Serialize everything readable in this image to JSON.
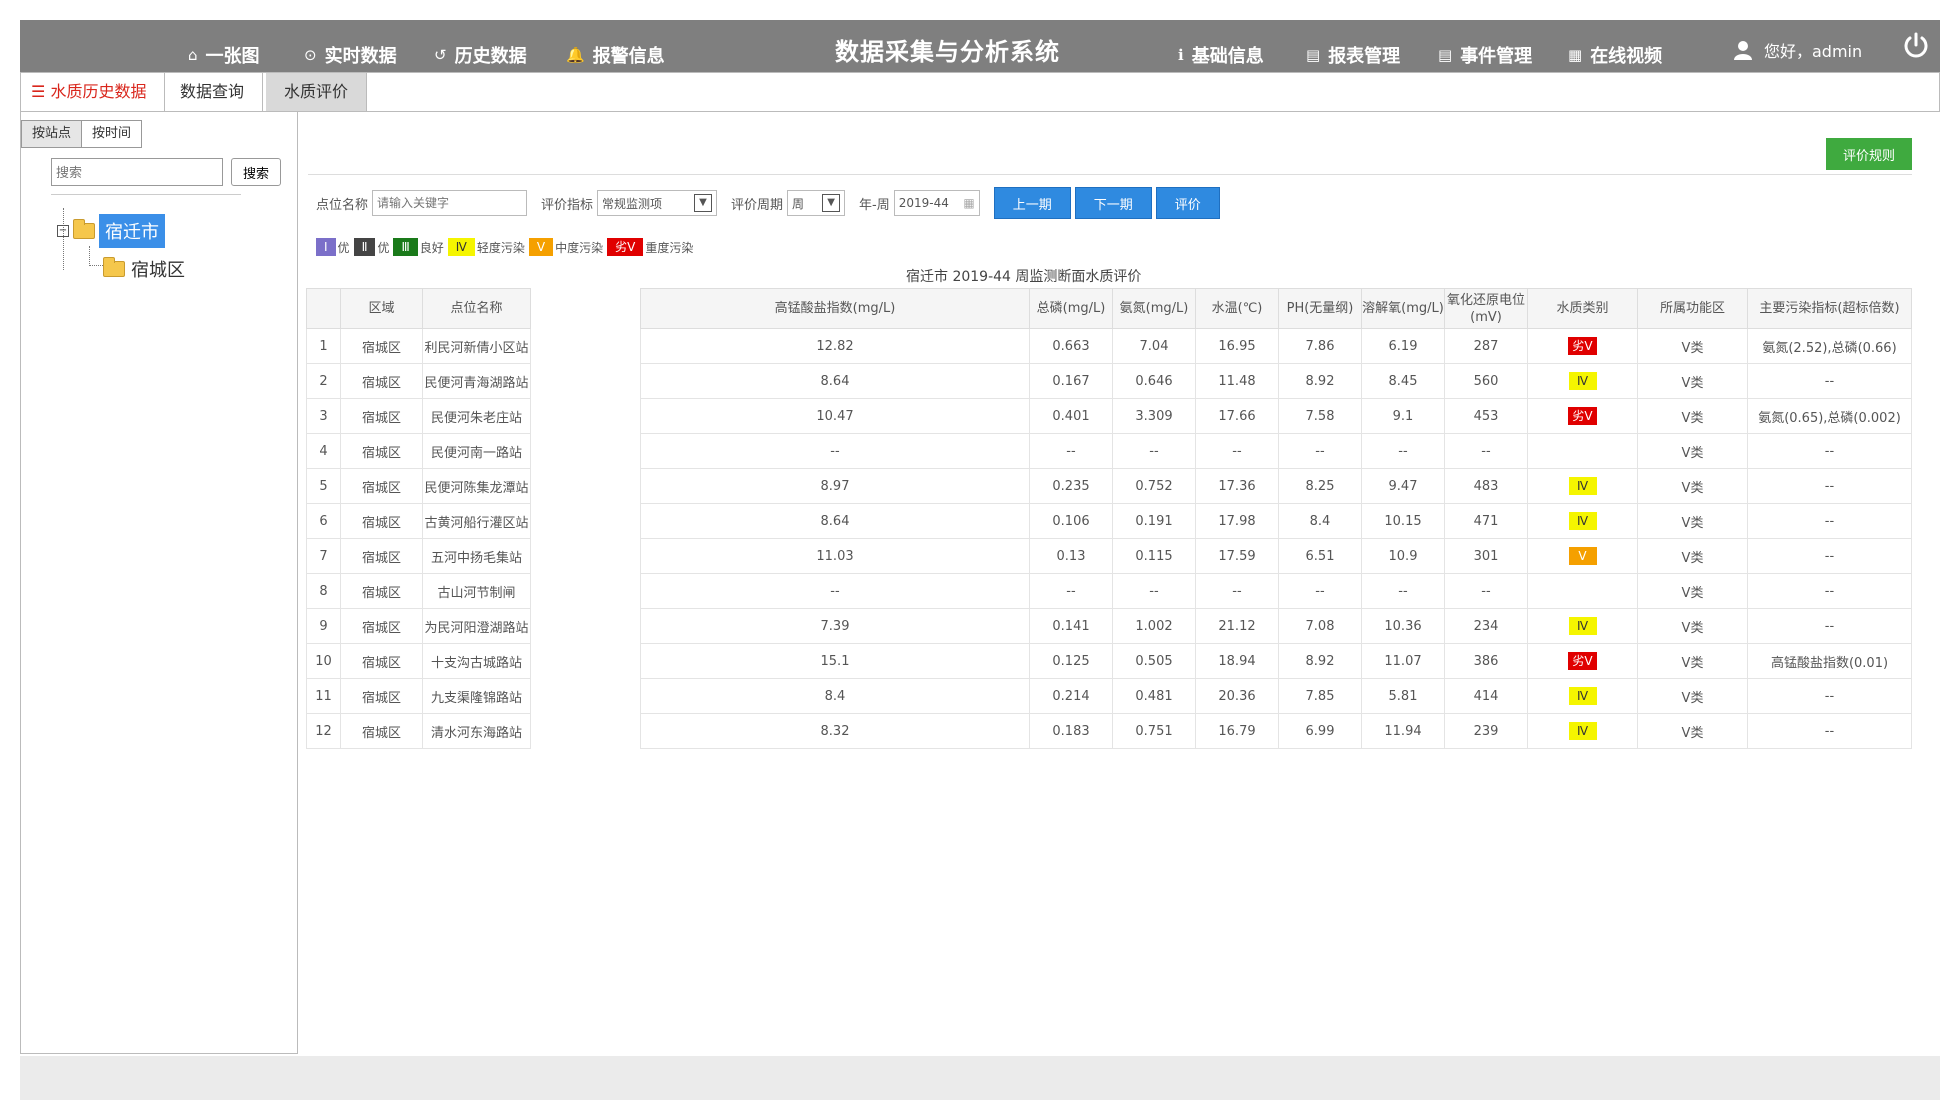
{
  "header": {
    "title": "数据采集与分析系统",
    "nav_left": [
      {
        "icon": "⌂",
        "label": "一张图"
      },
      {
        "icon": "⊙",
        "label": "实时数据"
      },
      {
        "icon": "↺",
        "label": "历史数据"
      },
      {
        "icon": "🔔",
        "label": "报警信息"
      }
    ],
    "nav_right": [
      {
        "icon": "ℹ",
        "label": "基础信息"
      },
      {
        "icon": "▤",
        "label": "报表管理"
      },
      {
        "icon": "▤",
        "label": "事件管理"
      },
      {
        "icon": "▦",
        "label": "在线视频"
      }
    ],
    "greeting": "您好，admin"
  },
  "tabs": {
    "menu_label": "水质历史数据",
    "items": [
      "数据查询",
      "水质评价"
    ]
  },
  "sidebar": {
    "btn_station": "按站点",
    "btn_time": "按时间",
    "search_placeholder": "搜索",
    "search_label": "搜索",
    "tree_root": "宿迁市",
    "tree_child": "宿城区"
  },
  "toolbar": {
    "rule_label": "评价规则",
    "site_label": "点位名称",
    "site_placeholder": "请输入关键字",
    "index_label": "评价指标",
    "index_value": "常规监测项",
    "period_label": "评价周期",
    "period_value": "周",
    "week_label": "年-周",
    "week_value": "2019-44",
    "prev_label": "上一期",
    "next_label": "下一期",
    "eval_label": "评价"
  },
  "legend": [
    {
      "mark": "Ⅰ",
      "text": "优",
      "color": "#7b6fc9",
      "fg": "#fff"
    },
    {
      "mark": "Ⅱ",
      "text": "优",
      "color": "#444444",
      "fg": "#fff"
    },
    {
      "mark": "Ⅲ",
      "text": "良好",
      "color": "#1a7a1a",
      "fg": "#fff"
    },
    {
      "mark": "Ⅳ",
      "text": "轻度污染",
      "color": "#f5f500",
      "fg": "#333"
    },
    {
      "mark": "Ⅴ",
      "text": "中度污染",
      "color": "#f5a000",
      "fg": "#fff"
    },
    {
      "mark": "劣Ⅴ",
      "text": "重度污染",
      "color": "#e00000",
      "fg": "#fff"
    }
  ],
  "table": {
    "title": "宿迁市 2019-44 周监测断面水质评价",
    "headers": [
      "",
      "区域",
      "点位名称",
      "高锰酸盐指数(mg/L)",
      "总磷(mg/L)",
      "氨氮(mg/L)",
      "水温(℃)",
      "PH(无量纲)",
      "溶解氧(mg/L)",
      "氧化还原电位(mV)",
      "水质类别",
      "所属功能区",
      "主要污染指标(超标倍数)"
    ],
    "rows": [
      [
        "1",
        "宿城区",
        "利民河新倩小区站",
        "12.82",
        "0.663",
        "7.04",
        "16.95",
        "7.86",
        "6.19",
        "287",
        "劣Ⅴ",
        "Ⅴ类",
        "氨氮(2.52),总磷(0.66)"
      ],
      [
        "2",
        "宿城区",
        "民便河青海湖路站",
        "8.64",
        "0.167",
        "0.646",
        "11.48",
        "8.92",
        "8.45",
        "560",
        "Ⅳ",
        "Ⅴ类",
        "--"
      ],
      [
        "3",
        "宿城区",
        "民便河朱老庄站",
        "10.47",
        "0.401",
        "3.309",
        "17.66",
        "7.58",
        "9.1",
        "453",
        "劣Ⅴ",
        "Ⅴ类",
        "氨氮(0.65),总磷(0.002)"
      ],
      [
        "4",
        "宿城区",
        "民便河南一路站",
        "--",
        "--",
        "--",
        "--",
        "--",
        "--",
        "--",
        "",
        "Ⅴ类",
        "--"
      ],
      [
        "5",
        "宿城区",
        "民便河陈集龙潭站",
        "8.97",
        "0.235",
        "0.752",
        "17.36",
        "8.25",
        "9.47",
        "483",
        "Ⅳ",
        "Ⅴ类",
        "--"
      ],
      [
        "6",
        "宿城区",
        "古黄河船行灌区站",
        "8.64",
        "0.106",
        "0.191",
        "17.98",
        "8.4",
        "10.15",
        "471",
        "Ⅳ",
        "Ⅴ类",
        "--"
      ],
      [
        "7",
        "宿城区",
        "五河中扬毛集站",
        "11.03",
        "0.13",
        "0.115",
        "17.59",
        "6.51",
        "10.9",
        "301",
        "Ⅴ",
        "Ⅴ类",
        "--"
      ],
      [
        "8",
        "宿城区",
        "古山河节制闸",
        "--",
        "--",
        "--",
        "--",
        "--",
        "--",
        "--",
        "",
        "Ⅴ类",
        "--"
      ],
      [
        "9",
        "宿城区",
        "为民河阳澄湖路站",
        "7.39",
        "0.141",
        "1.002",
        "21.12",
        "7.08",
        "10.36",
        "234",
        "Ⅳ",
        "Ⅴ类",
        "--"
      ],
      [
        "10",
        "宿城区",
        "十支沟古城路站",
        "15.1",
        "0.125",
        "0.505",
        "18.94",
        "8.92",
        "11.07",
        "386",
        "劣Ⅴ",
        "Ⅴ类",
        "高锰酸盐指数(0.01)"
      ],
      [
        "11",
        "宿城区",
        "九支渠隆锦路站",
        "8.4",
        "0.214",
        "0.481",
        "20.36",
        "7.85",
        "5.81",
        "414",
        "Ⅳ",
        "Ⅴ类",
        "--"
      ],
      [
        "12",
        "宿城区",
        "清水河东海路站",
        "8.32",
        "0.183",
        "0.751",
        "16.79",
        "6.99",
        "11.94",
        "239",
        "Ⅳ",
        "Ⅴ类",
        "--"
      ]
    ]
  },
  "category_colors": {
    "劣Ⅴ": {
      "bg": "#e00000",
      "fg": "#fff"
    },
    "Ⅳ": {
      "bg": "#f5f500",
      "fg": "#333"
    },
    "Ⅴ": {
      "bg": "#f5a000",
      "fg": "#fff"
    }
  }
}
